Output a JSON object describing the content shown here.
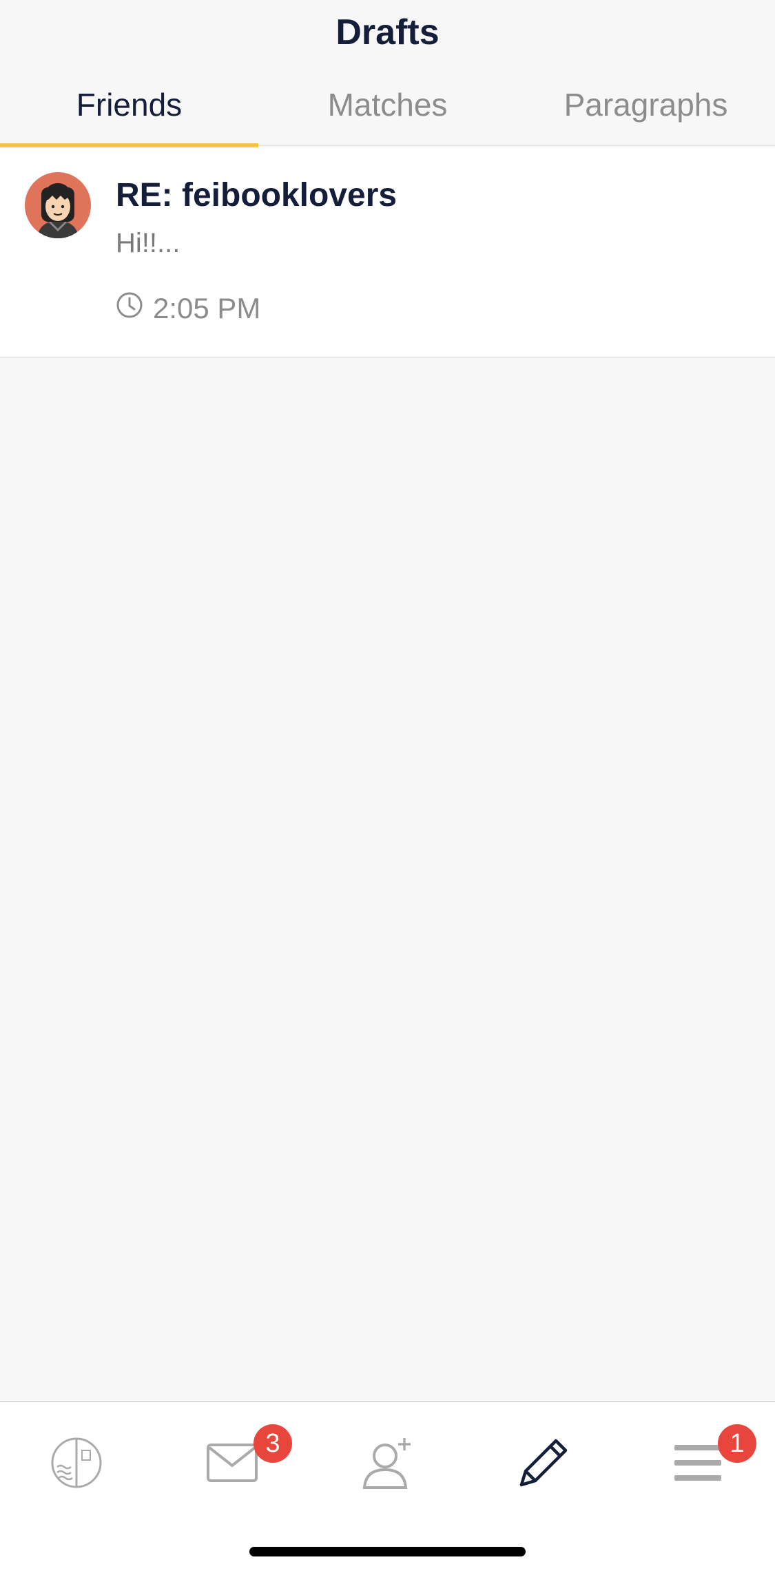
{
  "header": {
    "title": "Drafts",
    "tabs": [
      {
        "label": "Friends",
        "active": true
      },
      {
        "label": "Matches",
        "active": false
      },
      {
        "label": "Paragraphs",
        "active": false
      }
    ]
  },
  "drafts": [
    {
      "subject": "RE: feibooklovers",
      "preview": "Hi!!...",
      "time": "2:05 PM",
      "avatar_icon": "avatar-icon"
    }
  ],
  "bottom_nav": {
    "items": [
      {
        "name": "stamp-icon",
        "badge": ""
      },
      {
        "name": "mail-icon",
        "badge": "3"
      },
      {
        "name": "add-friend-icon",
        "badge": ""
      },
      {
        "name": "pencil-icon",
        "badge": ""
      },
      {
        "name": "menu-icon",
        "badge": "1"
      }
    ]
  },
  "colors": {
    "accent": "#f6c445",
    "badge": "#e8453c",
    "text_dark": "#141d3a",
    "avatar_bg": "#e0745a"
  }
}
